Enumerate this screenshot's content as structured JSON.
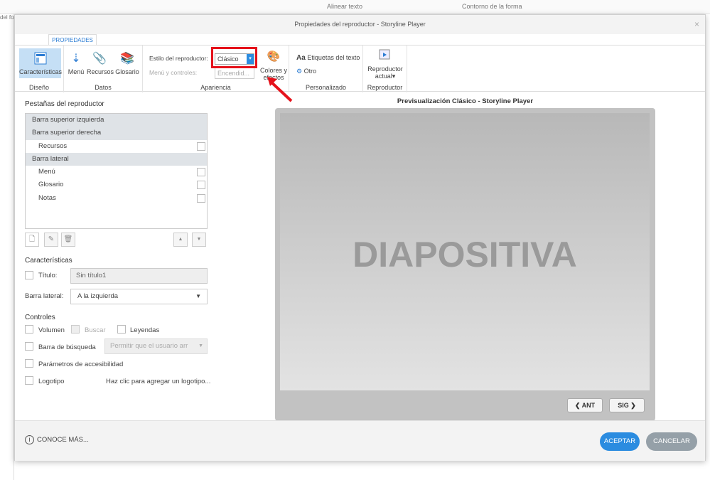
{
  "background": {
    "left_texts": [
      "del foco"
    ],
    "toolbar_items": [
      "Alinear texto",
      "Contorno de la forma"
    ]
  },
  "dialog": {
    "title": "Propiedades del reproductor - Storyline Player",
    "close": "×"
  },
  "ribbon": {
    "tab": "PROPIEDADES",
    "groups": {
      "diseno": "Diseño",
      "datos": "Datos",
      "apariencia": "Apariencia",
      "personalizado": "Personalizado",
      "reproductor": "Reproductor"
    },
    "caracteristicas": "Características",
    "menu": "Menú",
    "recursos": "Recursos",
    "glosario": "Glosario",
    "estilo_label": "Estilo del reproductor:",
    "estilo_value": "Clásico",
    "menu_controles_label": "Menú y controles:",
    "menu_controles_value": "Encendid...",
    "colores": "Colores y",
    "colores2": "efectos",
    "etiquetas": "Etiquetas del texto",
    "aa": "Aa",
    "otro": "Otro",
    "reproductor_actual": "Reproductor",
    "reproductor_actual2": "actual"
  },
  "left": {
    "tabs_title": "Pestañas del reproductor",
    "items": [
      {
        "label": "Barra superior izquierda",
        "type": "header"
      },
      {
        "label": "Barra superior derecha",
        "type": "header"
      },
      {
        "label": "Recursos",
        "type": "sub"
      },
      {
        "label": "Barra lateral",
        "type": "header"
      },
      {
        "label": "Menú",
        "type": "sub"
      },
      {
        "label": "Glosario",
        "type": "sub"
      },
      {
        "label": "Notas",
        "type": "sub"
      }
    ],
    "features_title": "Características",
    "titulo_label": "Título:",
    "titulo_value": "Sin título1",
    "barra_lateral_label": "Barra lateral:",
    "barra_lateral_value": "A la izquierda",
    "controls_title": "Controles",
    "volumen": "Volumen",
    "buscar": "Buscar",
    "leyendas": "Leyendas",
    "barra_busqueda": "Barra de búsqueda",
    "barra_busqueda_value": "Permitir que el usuario arr",
    "accesibilidad": "Parámetros de accesibilidad",
    "logotipo": "Logotipo",
    "logotipo_hint": "Haz clic para agregar un logotipo..."
  },
  "preview": {
    "title": "Previsualización Clásico - Storyline Player",
    "slide_text": "DIAPOSITIVA",
    "prev": "❮ ANT",
    "next": "SIG ❯"
  },
  "footer": {
    "learn_more": "CONOCE MÁS...",
    "accept": "ACEPTAR",
    "cancel": "CANCELAR"
  },
  "colors": {
    "accent": "#2b8ce0",
    "highlight": "#e5121b"
  }
}
